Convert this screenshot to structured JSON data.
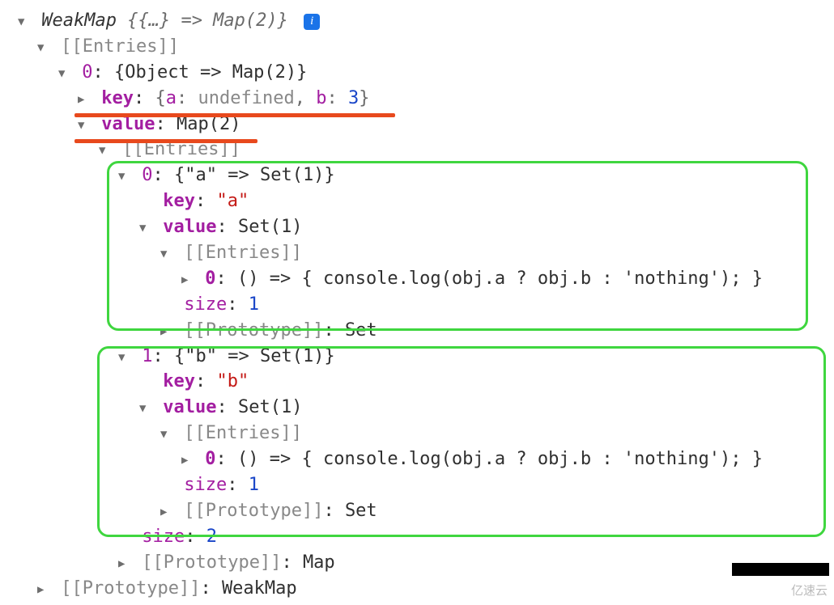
{
  "root": {
    "summary_prefix": "WeakMap ",
    "summary_braces": "{{…} => Map(2)}",
    "entries_label": "[[Entries]]",
    "item0": {
      "index": "0",
      "summary": "{Object => Map(2)}",
      "key_label": "key",
      "key_open": "{",
      "key_a_name": "a",
      "key_a_val": "undefined",
      "key_sep": ", ",
      "key_b_name": "b",
      "key_b_val": "3",
      "key_close": "}",
      "value_label": "value",
      "value_summary": "Map(2)",
      "entries_label": "[[Entries]]",
      "map0": {
        "index": "0",
        "summary": "{\"a\" => Set(1)}",
        "key_label": "key",
        "key_val": "\"a\"",
        "value_label": "value",
        "value_summary": "Set(1)",
        "entries_label": "[[Entries]]",
        "entry_index": "0",
        "entry_body": "() => { console.log(obj.a ? obj.b : 'nothing'); }",
        "size_label": "size",
        "size_val": "1",
        "proto_label": "[[Prototype]]",
        "proto_val": "Set"
      },
      "map1": {
        "index": "1",
        "summary": "{\"b\" => Set(1)}",
        "key_label": "key",
        "key_val": "\"b\"",
        "value_label": "value",
        "value_summary": "Set(1)",
        "entries_label": "[[Entries]]",
        "entry_index": "0",
        "entry_body": "() => { console.log(obj.a ? obj.b : 'nothing'); }",
        "size_label": "size",
        "size_val": "1",
        "proto_label": "[[Prototype]]",
        "proto_val": "Set"
      },
      "map_size_label": "size",
      "map_size_val": "2",
      "map_proto_label": "[[Prototype]]",
      "map_proto_val": "Map"
    },
    "proto_label": "[[Prototype]]",
    "proto_val": "WeakMap"
  },
  "watermark": "亿速云",
  "colors": {
    "purple": "#a31ea1",
    "string": "#c41a16",
    "number": "#1a46c8",
    "gray": "#888",
    "underline": "#e8491d",
    "green_box": "#3fd63f"
  }
}
